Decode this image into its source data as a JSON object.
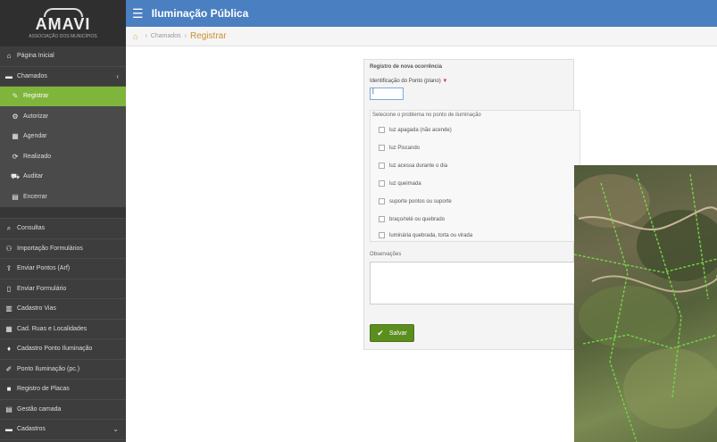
{
  "logo": {
    "name": "AMAVI",
    "sub": "ASSOCIAÇÃO DOS MUNICÍPIOS"
  },
  "sidebar": {
    "top_items": [
      {
        "label": "Página Inicial",
        "icon": "home-icon"
      },
      {
        "label": "Chamados",
        "icon": "folder-icon"
      }
    ],
    "sub_items": [
      {
        "label": "Registrar",
        "icon": "pencil-icon",
        "active": true
      },
      {
        "label": "Autorizar",
        "icon": "gear-icon"
      },
      {
        "label": "Agendar",
        "icon": "calendar-icon"
      },
      {
        "label": "Realizado",
        "icon": "refresh-icon"
      },
      {
        "label": "Auditar",
        "icon": "truck-icon"
      },
      {
        "label": "Encerrar",
        "icon": "document-icon"
      }
    ],
    "bottom_items": [
      {
        "label": "Consultas",
        "icon": "search-icon"
      },
      {
        "label": "Importação Formulários",
        "icon": "people-icon"
      },
      {
        "label": "Enviar Pontos (Arf)",
        "icon": "upload-icon"
      },
      {
        "label": "Enviar Formulário",
        "icon": "file-icon"
      },
      {
        "label": "Cadastro Vias",
        "icon": "map-icon"
      },
      {
        "label": "Cad. Ruas e Localidades",
        "icon": "grid-icon"
      },
      {
        "label": "Cadastro Ponto Iluminação",
        "icon": "lightbulb-icon"
      },
      {
        "label": "Ponto Iluminação (pc.)",
        "icon": "wrench-icon"
      },
      {
        "label": "Registro de Placas",
        "icon": "tag-icon"
      },
      {
        "label": "Gestão camada",
        "icon": "layers-icon"
      },
      {
        "label": "Cadastros",
        "icon": "folder-icon"
      }
    ]
  },
  "topbar": {
    "title": "Iluminação Pública"
  },
  "breadcrumb": {
    "parent": "Chamados",
    "current": "Registrar"
  },
  "form": {
    "section_title": "Registro de nova ocorrência",
    "id_label": "Identificação do Ponto (plano)",
    "id_value": "|",
    "problems_title": "Selecione o problema no ponto de iluminação",
    "problems": [
      "luz apagada (não acende)",
      "luz Piscando",
      "luz acessa durante o dia",
      "luz queimada",
      "suporte pontos ou suporte",
      "braço/relé ou quebrado",
      "luminária quebrada, torta ou virada"
    ],
    "obs_label": "Observações",
    "save_label": "Salvar"
  }
}
